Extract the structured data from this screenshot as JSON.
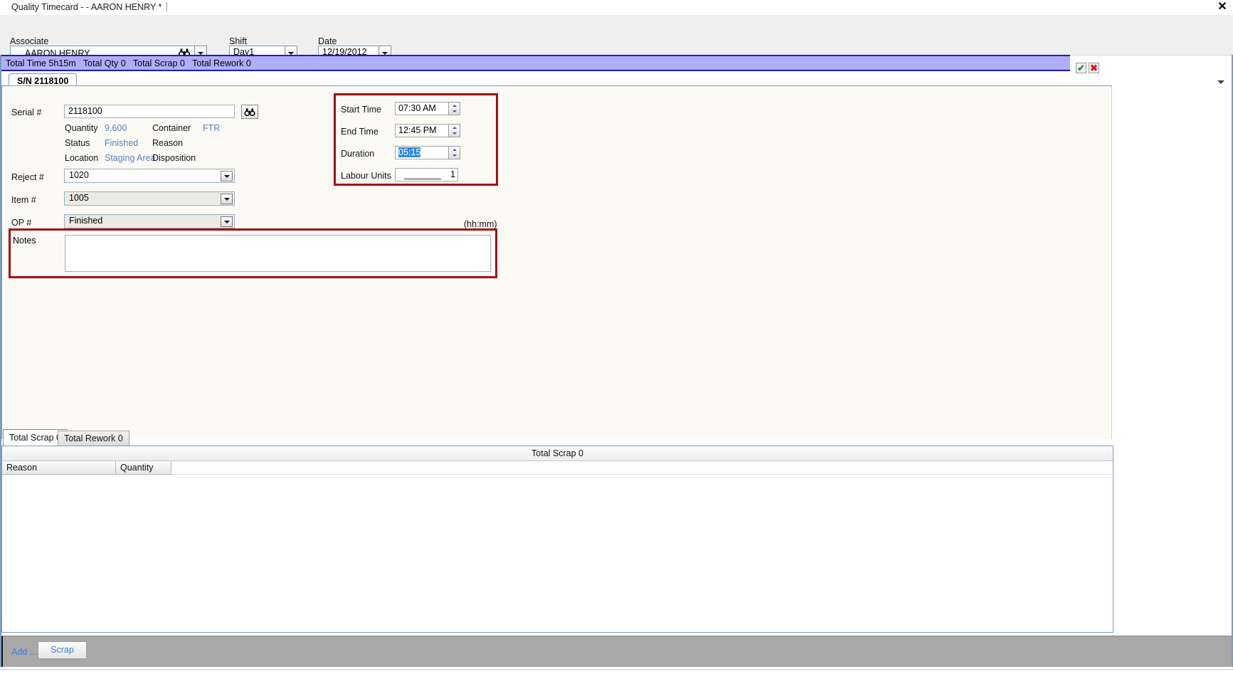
{
  "window": {
    "tab_title": "Quality Timecard - - AARON HENRY *",
    "close_label": "✕"
  },
  "filters": {
    "associate_label": "Associate",
    "associate_value": "AARON HENRY",
    "shift_label": "Shift",
    "shift_value": "Day1",
    "date_label": "Date",
    "date_value": "12/19/2012"
  },
  "totals_bar": {
    "total_time_label": "Total Time 5h15m",
    "total_qty_label": "Total Qty 0",
    "total_scrap_label": "Total Scrap 0",
    "total_rework_label": "Total Rework 0"
  },
  "actions": {
    "accept_label": "✔",
    "reject_label": "✖"
  },
  "record_tab": {
    "label": "S/N 2118100"
  },
  "form": {
    "serial_label": "Serial #",
    "serial_value": "2118100",
    "quantity_label": "Quantity",
    "quantity_value": "9,600",
    "container_label": "Container",
    "container_value": "FTR",
    "status_label": "Status",
    "status_value": "Finished",
    "reason_label": "Reason",
    "reason_value": "",
    "location_label": "Location",
    "location_value": "Staging Area",
    "disposition_label": "Disposition",
    "disposition_value": "",
    "reject_label": "Reject #",
    "reject_value": "1020",
    "item_label": "Item #",
    "item_value": "1005",
    "op_label": "OP #",
    "op_value": "Finished",
    "notes_label": "Notes",
    "notes_value": ""
  },
  "time_panel": {
    "start_time_label": "Start Time",
    "start_time_value": "07:30 AM",
    "end_time_label": "End Time",
    "end_time_value": "12:45 PM",
    "duration_label": "Duration",
    "duration_value": "05:15",
    "duration_hint": "(hh:mm)",
    "labour_units_label": "Labour Units",
    "labour_units_value": "1"
  },
  "lower_tabs": {
    "scrap_tab_label": "Total Scrap 0",
    "rework_tab_label": "Total Rework 0"
  },
  "grid": {
    "title": "Total Scrap 0",
    "columns": [
      "Reason",
      "Quantity"
    ],
    "rows": []
  },
  "action_bar": {
    "add_label": "Add ...",
    "scrap_label": "Scrap"
  },
  "colors": {
    "accent_blue": "#5a7fc4",
    "highlight_purple": "#aeaefb",
    "highlight_red": "#a70d11",
    "selection_blue": "#2f8ae8",
    "link_blue": "#3a7fe0"
  }
}
